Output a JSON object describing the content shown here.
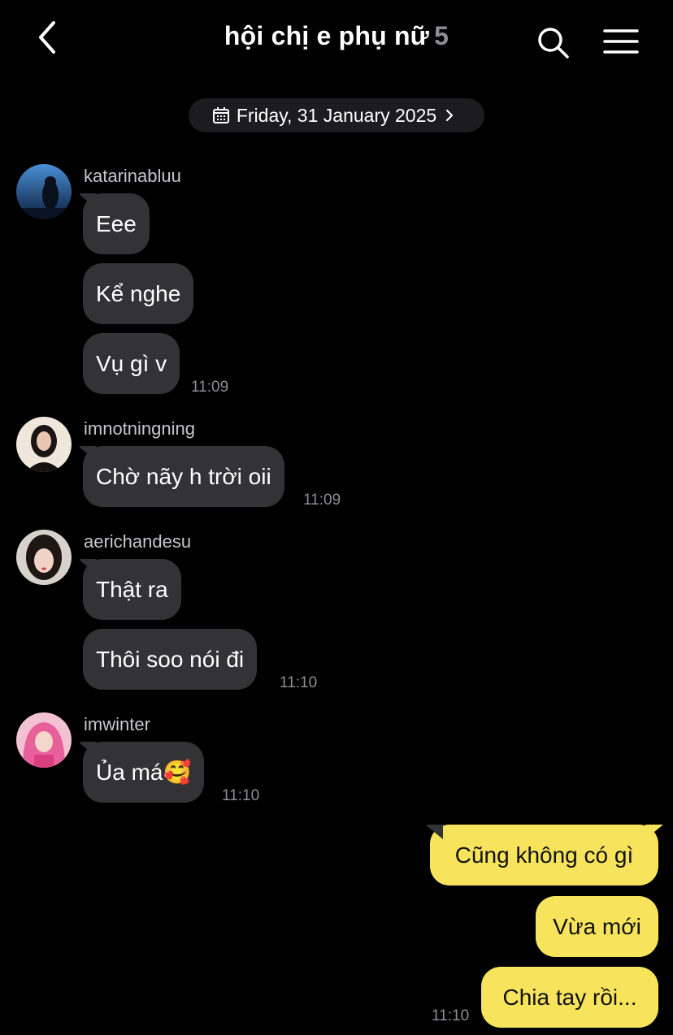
{
  "colors": {
    "background": "#000000",
    "incoming_bubble": "#333335",
    "outgoing_bubble": "#f7e45c",
    "secondary_text": "#8e8e93"
  },
  "header": {
    "back_icon": "chevron-left-icon",
    "title": "hội chị e phụ nữ",
    "member_count": "5",
    "search_icon": "search-icon",
    "menu_icon": "hamburger-menu-icon"
  },
  "date_divider": {
    "icon": "calendar-icon",
    "label": "Friday, 31 January 2025",
    "chevron_icon": "chevron-right-icon"
  },
  "groups": [
    {
      "username": "katarinabluu",
      "messages": [
        "Eee",
        "Kể nghe",
        "Vụ gì v"
      ],
      "time": "11:09"
    },
    {
      "username": "imnotningning",
      "messages": [
        "Chờ nãy h trời oii"
      ],
      "time": "11:09"
    },
    {
      "username": "aerichandesu",
      "messages": [
        "Thật ra",
        "Thôi soo nói đi"
      ],
      "time": "11:10"
    },
    {
      "username": "imwinter",
      "messages": [
        "Ủa má🥰"
      ],
      "time": "11:10"
    }
  ],
  "my_messages": {
    "messages": [
      "Cũng không có gì",
      "Vừa mới",
      "Chia tay rồi..."
    ],
    "time": "11:10"
  }
}
